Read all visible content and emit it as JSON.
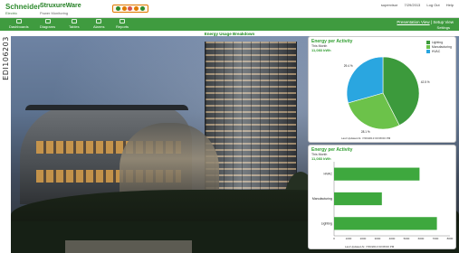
{
  "side_code": "EDI106203",
  "header": {
    "brand_schneider": "Schneider",
    "brand_schneider_sub": "Electric",
    "brand_struxure": "StruxureWare",
    "brand_struxure_sub": "Power Monitoring",
    "top_right": [
      "supervisor",
      "7/29/2013",
      "Log Out",
      "Help"
    ]
  },
  "status_dots": [
    "#2e8b2e",
    "#e07a00",
    "#d9534f",
    "#e07a00",
    "#2e8b2e"
  ],
  "nav": {
    "items": [
      "Dashboards",
      "Diagrams",
      "Tables",
      "Alarms",
      "Reports"
    ],
    "settings": "Settings",
    "views": [
      "Presentation View",
      "Setup View"
    ]
  },
  "page_title": "Energy Usage Breakdown",
  "panels": {
    "pie": {
      "title": "Energy per Activity",
      "subtitle": "This Month",
      "total": "11,083 kWh",
      "updated": "Last Updated At: 7/29/2013 03:08:00 PM"
    },
    "bar": {
      "title": "Energy per Activity",
      "subtitle": "This Month",
      "total": "11,083 kWh",
      "updated": "Last Updated At: 7/29/2013 03:08:00 PM"
    }
  },
  "colors": {
    "lighting": "#3c9a3c",
    "manufacturing": "#6cc24a",
    "hvac": "#2aa6e0",
    "bar": "#3ea83e",
    "accent": "#2f9d2f",
    "nav": "#3f9b3f"
  },
  "chart_data": [
    {
      "type": "pie",
      "title": "Energy per Activity",
      "categories": [
        "Lighting",
        "Manufacturing",
        "HVAC"
      ],
      "values": [
        42.5,
        28.1,
        29.4
      ],
      "labels": [
        "42.5 %",
        "28.1 %",
        "29.4 %"
      ],
      "legend": "top-right"
    },
    {
      "type": "bar",
      "orientation": "horizontal",
      "title": "Energy per Activity",
      "categories": [
        "HVAC",
        "Manufacturing",
        "Lighting"
      ],
      "values": [
        5900,
        3300,
        7100
      ],
      "xlim": [
        0,
        8000
      ],
      "xticks": [
        "0",
        "1000",
        "2000",
        "3000",
        "4000",
        "5000",
        "6000",
        "7000",
        "8000"
      ],
      "grid": false
    }
  ]
}
